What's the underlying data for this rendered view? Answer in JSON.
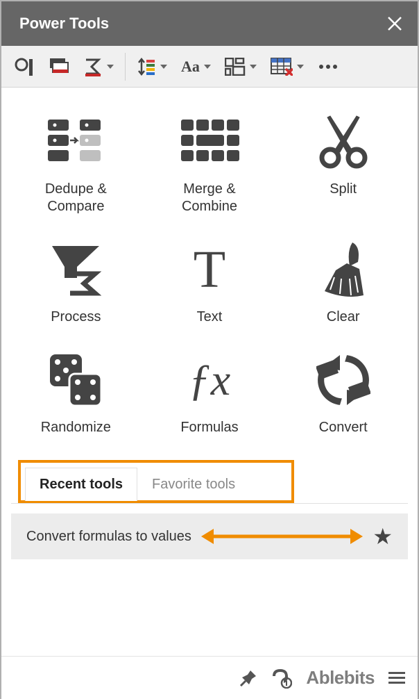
{
  "title": "Power Tools",
  "toolbar": {
    "group1": [
      "search",
      "fill",
      "sum"
    ],
    "group2": [
      "sort",
      "textcase",
      "layout",
      "table",
      "more"
    ]
  },
  "tools": [
    {
      "key": "dedupe",
      "label": "Dedupe &\nCompare"
    },
    {
      "key": "merge",
      "label": "Merge &\nCombine"
    },
    {
      "key": "split",
      "label": "Split"
    },
    {
      "key": "process",
      "label": "Process"
    },
    {
      "key": "text",
      "label": "Text"
    },
    {
      "key": "clear",
      "label": "Clear"
    },
    {
      "key": "randomize",
      "label": "Randomize"
    },
    {
      "key": "formulas",
      "label": "Formulas"
    },
    {
      "key": "convert",
      "label": "Convert"
    }
  ],
  "tabs": {
    "recent": "Recent tools",
    "favorite": "Favorite tools"
  },
  "recent_item": "Convert formulas to values",
  "brand": "Ablebits"
}
